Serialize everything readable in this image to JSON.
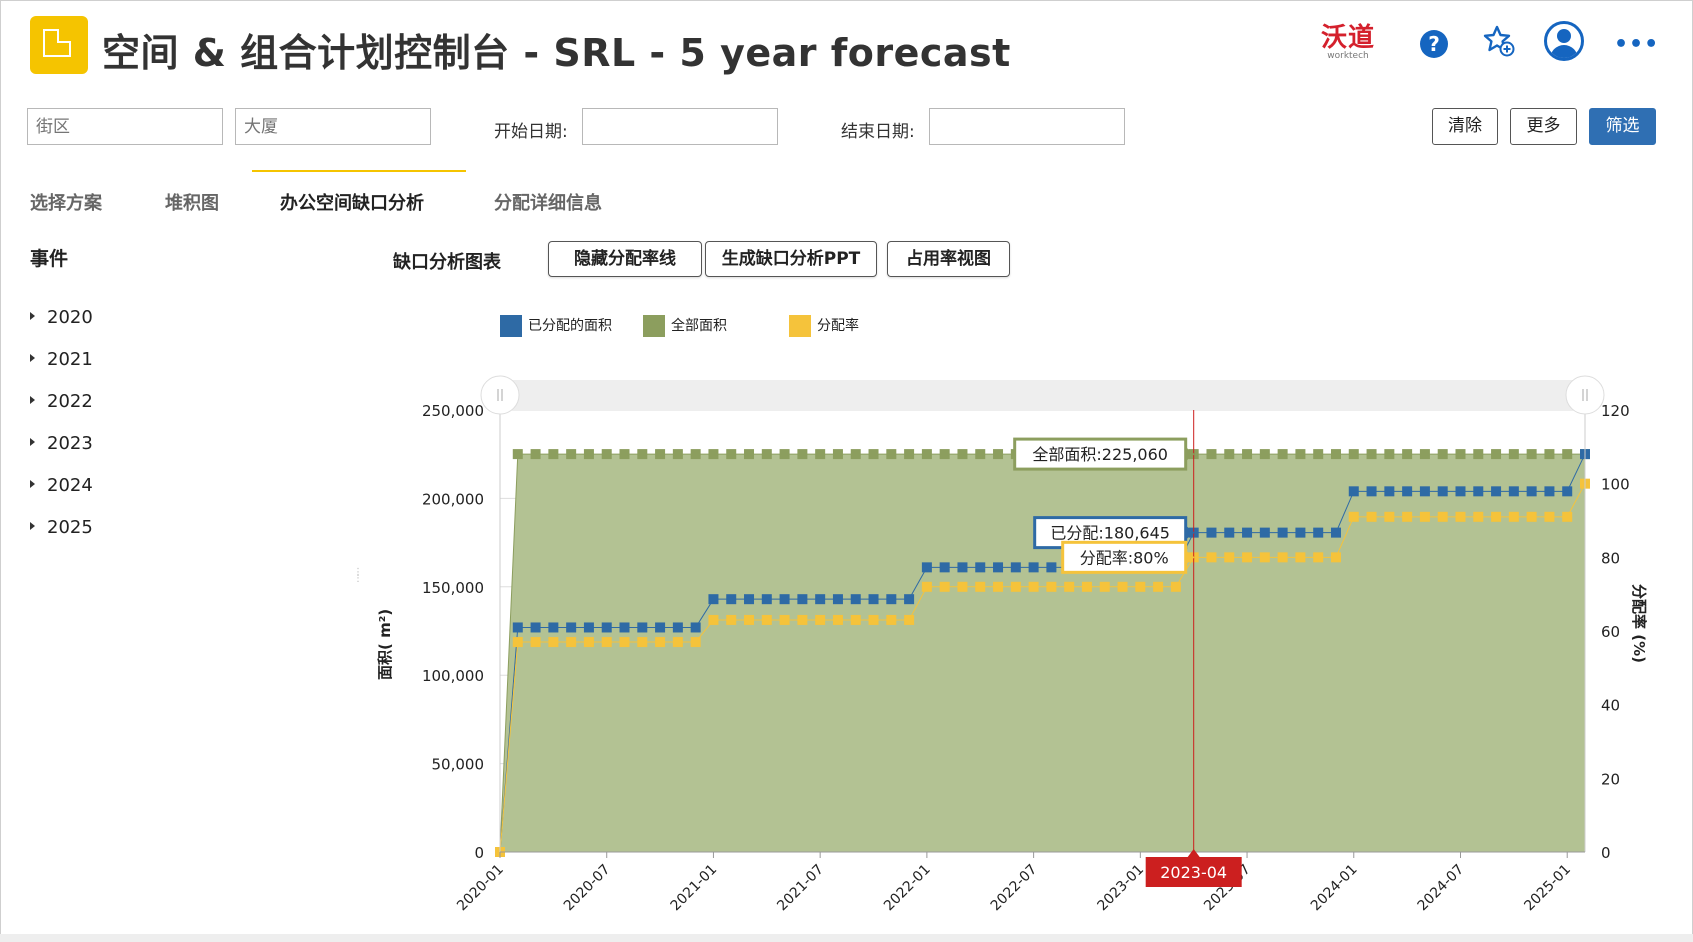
{
  "header": {
    "title": "空间 & 组合计划控制台 - SRL - 5 year forecast",
    "brand_cn": "沃道",
    "brand_en": "worktech",
    "help_glyph": "?",
    "more_glyph": "•••"
  },
  "filters": {
    "block_placeholder": "街区",
    "building_placeholder": "大厦",
    "start_label": "开始日期:",
    "end_label": "结束日期:",
    "start_value": "",
    "end_value": "",
    "clear_label": "清除",
    "more_label": "更多",
    "filter_label": "筛选"
  },
  "tabs": [
    {
      "label": "选择方案",
      "active": false
    },
    {
      "label": "堆积图",
      "active": false
    },
    {
      "label": "办公空间缺口分析",
      "active": true
    },
    {
      "label": "分配详细信息",
      "active": false
    }
  ],
  "sidebar": {
    "title": "事件",
    "years": [
      "2020",
      "2021",
      "2022",
      "2023",
      "2024",
      "2025"
    ]
  },
  "chart_toolbar": {
    "heading": "缺口分析图表",
    "buttons": [
      "隐藏分配率线",
      "生成缺口分析PPT",
      "占用率视图"
    ]
  },
  "colors": {
    "allocated": "#2e6aa5",
    "total": "#8c9e5e",
    "rate": "#f5c33b",
    "area_fill": "#b3c293",
    "cursor": "#cc1f1f"
  },
  "chart_data": {
    "type": "area",
    "xlabel": "",
    "ylabel": "面积( m²)",
    "y2label": "分配率 (%)",
    "ylim": [
      0,
      250000
    ],
    "y2lim": [
      0,
      120
    ],
    "yticks": [
      "0",
      "50,000",
      "100,000",
      "150,000",
      "200,000",
      "250,000"
    ],
    "y2ticks": [
      "0",
      "20",
      "40",
      "60",
      "80",
      "100",
      "120"
    ],
    "xticks": [
      "2020-01",
      "2020-07",
      "2021-01",
      "2021-07",
      "2022-01",
      "2022-07",
      "2023-01",
      "2023-07",
      "2024-01",
      "2024-07",
      "2025-01"
    ],
    "legend": [
      "已分配的面积",
      "全部面积",
      "分配率"
    ],
    "legend_position": "top",
    "series": [
      {
        "name": "已分配的面积",
        "axis": "left",
        "segments": [
          {
            "from": "2020-01",
            "to": "2020-01",
            "value": 0
          },
          {
            "from": "2020-02",
            "to": "2020-12",
            "value": 127000
          },
          {
            "from": "2021-01",
            "to": "2021-12",
            "value": 143000
          },
          {
            "from": "2022-01",
            "to": "2023-03",
            "value": 161000
          },
          {
            "from": "2023-04",
            "to": "2023-12",
            "value": 180645
          },
          {
            "from": "2024-01",
            "to": "2025-01",
            "value": 204000
          },
          {
            "from": "2025-02",
            "to": "2025-02",
            "value": 225060
          }
        ]
      },
      {
        "name": "全部面积",
        "axis": "left",
        "segments": [
          {
            "from": "2020-01",
            "to": "2020-01",
            "value": 0
          },
          {
            "from": "2020-02",
            "to": "2025-02",
            "value": 225060
          }
        ]
      },
      {
        "name": "分配率",
        "axis": "right",
        "segments": [
          {
            "from": "2020-01",
            "to": "2020-01",
            "value": 0
          },
          {
            "from": "2020-02",
            "to": "2020-12",
            "value": 57
          },
          {
            "from": "2021-01",
            "to": "2021-12",
            "value": 63
          },
          {
            "from": "2022-01",
            "to": "2023-03",
            "value": 72
          },
          {
            "from": "2023-04",
            "to": "2023-12",
            "value": 80
          },
          {
            "from": "2024-01",
            "to": "2025-01",
            "value": 91
          },
          {
            "from": "2025-02",
            "to": "2025-02",
            "value": 100
          }
        ]
      }
    ],
    "cursor": {
      "date": "2023-04",
      "tooltips": {
        "total": "全部面积:225,060",
        "allocated": "已分配:180,645",
        "rate": "分配率:80%"
      }
    },
    "grid": true
  }
}
